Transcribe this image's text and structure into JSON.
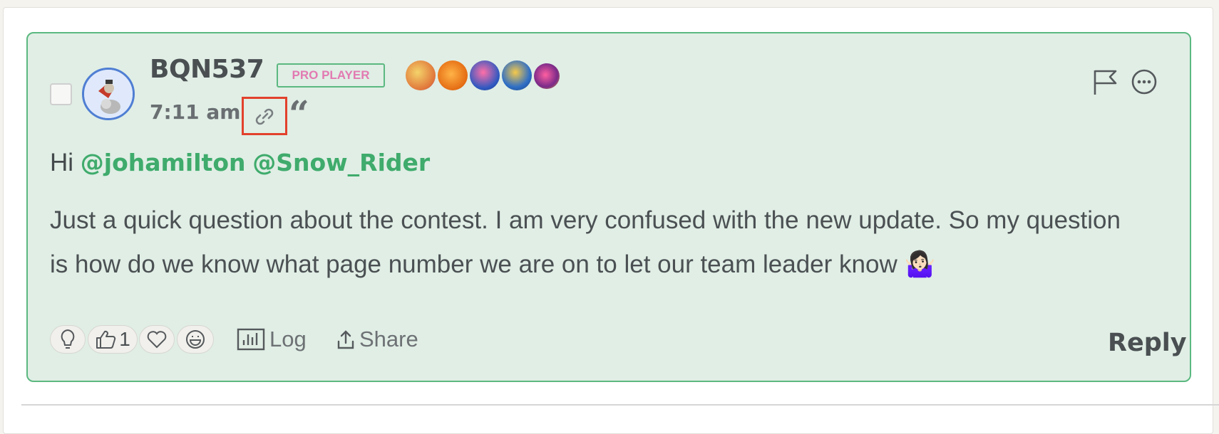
{
  "post": {
    "username": "BQN537",
    "badge_label": "PRO PLAYER",
    "timestamp": "7:11 am",
    "quote_glyph": "“",
    "greeting": "Hi",
    "mentions": [
      "@johamilton",
      "@Snow_Rider"
    ],
    "body": "Just a quick question about the contest. I am very confused with the new update. So my question is how do we know what page number we are on to let our team leader know 🤷🏻‍♀️",
    "icons": {
      "link": "link-icon",
      "quote": "quote-icon",
      "flag": "flag-icon",
      "more": "more-options-icon"
    },
    "achievement_badges": [
      {
        "name": "fruit-badge-icon",
        "color": "#e8b441"
      },
      {
        "name": "pumpkin-badge-icon",
        "color": "#f08a1f"
      },
      {
        "name": "candy-badge-icon",
        "color": "#3166c7"
      },
      {
        "name": "trophy-badge-icon",
        "color": "#2f6fc6"
      },
      {
        "name": "star-badge-icon",
        "color": "#7a2a8a"
      }
    ]
  },
  "footer": {
    "reactions": [
      {
        "icon": "lightbulb-icon",
        "count": ""
      },
      {
        "icon": "thumbs-up-icon",
        "count": "1"
      },
      {
        "icon": "heart-icon",
        "count": ""
      },
      {
        "icon": "laugh-icon",
        "count": ""
      }
    ],
    "log_label": "Log",
    "share_label": "Share",
    "reply_label": "Reply"
  },
  "colors": {
    "accent": "#3fab6c",
    "post_background": "#e0eee5",
    "highlight": "#e2412c",
    "badge_text": "#e27ab2"
  }
}
